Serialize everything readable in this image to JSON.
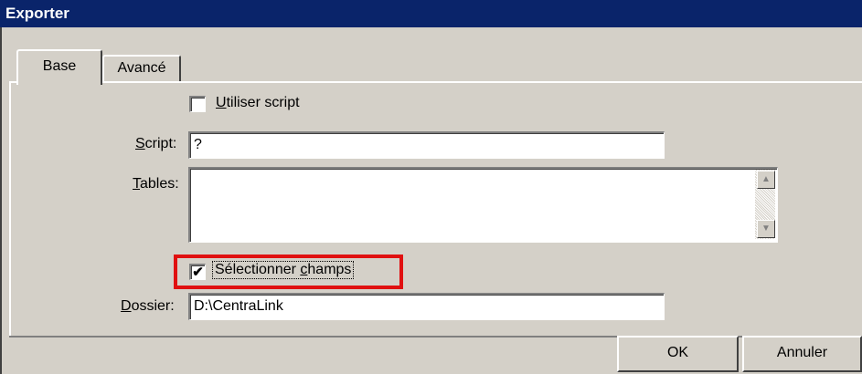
{
  "window": {
    "title": "Exporter"
  },
  "tabs": [
    {
      "label": "Base",
      "active": true
    },
    {
      "label": "Avancé",
      "active": false
    }
  ],
  "form": {
    "use_script": {
      "label_hotkey": "U",
      "label_rest": "tiliser script",
      "checked": false,
      "mark": ""
    },
    "script": {
      "label_hotkey": "S",
      "label_rest": "cript:",
      "value": "?"
    },
    "tables": {
      "label_hotkey": "T",
      "label_rest": "ables:",
      "items": []
    },
    "select_fields": {
      "label_start": "Sélectionner ",
      "label_hotkey": "c",
      "label_end": "hamps",
      "checked": true,
      "mark": "✔"
    },
    "folder": {
      "label_hotkey": "D",
      "label_rest": "ossier:",
      "value": "D:\\CentraLink"
    }
  },
  "buttons": {
    "ok": "OK",
    "cancel": "Annuler"
  },
  "icons": {
    "scroll_up": "triangle-up",
    "scroll_down": "triangle-down"
  },
  "colors": {
    "titlebar": "#0a246a",
    "highlight": "#e01010",
    "face": "#d4d0c8"
  },
  "glyphs": {
    "up": "▲",
    "down": "▼"
  }
}
